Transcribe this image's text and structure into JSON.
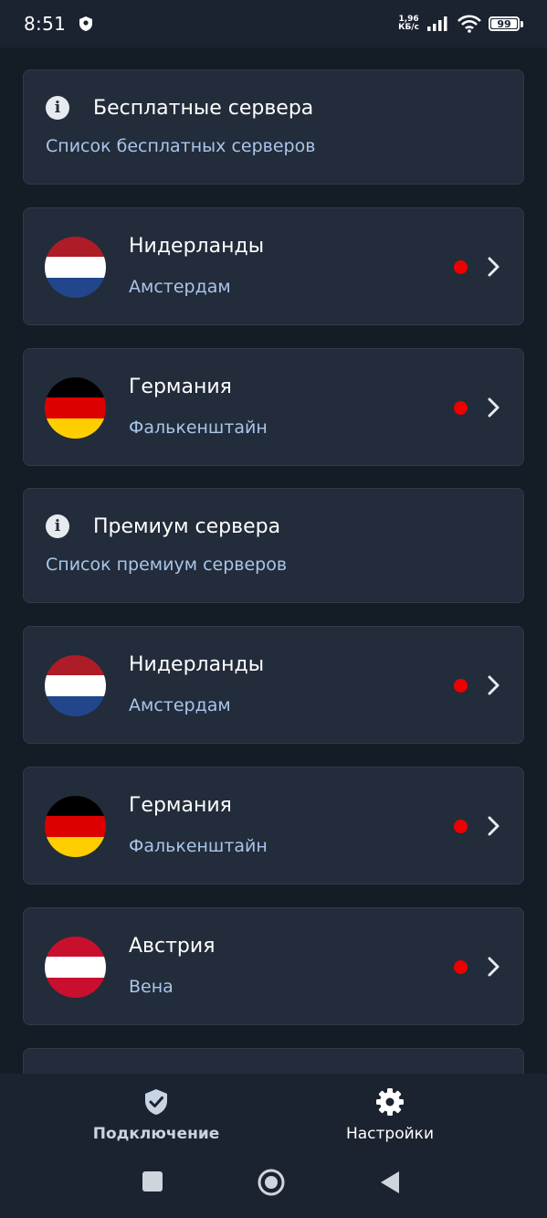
{
  "status_bar": {
    "time": "8:51",
    "net_speed_value": "1,96",
    "net_speed_unit": "КБ/с",
    "battery_level": "99"
  },
  "sections": [
    {
      "title": "Бесплатные сервера",
      "subtitle": "Список бесплатных серверов",
      "servers": [
        {
          "country": "Нидерланды",
          "city": "Амстердам",
          "flag_colors": [
            "#ae1c28",
            "#ffffff",
            "#21468b"
          ],
          "status_color": "#ee0000"
        },
        {
          "country": "Германия",
          "city": "Фалькенштайн",
          "flag_colors": [
            "#000000",
            "#dd0000",
            "#ffce00"
          ],
          "status_color": "#ee0000"
        }
      ]
    },
    {
      "title": "Премиум сервера",
      "subtitle": "Список премиум серверов",
      "servers": [
        {
          "country": "Нидерланды",
          "city": "Амстердам",
          "flag_colors": [
            "#ae1c28",
            "#ffffff",
            "#21468b"
          ],
          "status_color": "#ee0000"
        },
        {
          "country": "Германия",
          "city": "Фалькенштайн",
          "flag_colors": [
            "#000000",
            "#dd0000",
            "#ffce00"
          ],
          "status_color": "#ee0000"
        },
        {
          "country": "Австрия",
          "city": "Вена",
          "flag_colors": [
            "#c8102e",
            "#ffffff",
            "#c8102e"
          ],
          "status_color": "#ee0000"
        }
      ]
    }
  ],
  "bottom_nav": {
    "items": [
      {
        "label": "Подключение",
        "icon": "shield-check-icon",
        "active": true
      },
      {
        "label": "Настройки",
        "icon": "gear-icon",
        "active": false
      }
    ]
  },
  "colors": {
    "background": "#141c26",
    "card": "#222c3a",
    "subtitle_text": "#a9c5ea",
    "status_offline": "#ee0000"
  }
}
